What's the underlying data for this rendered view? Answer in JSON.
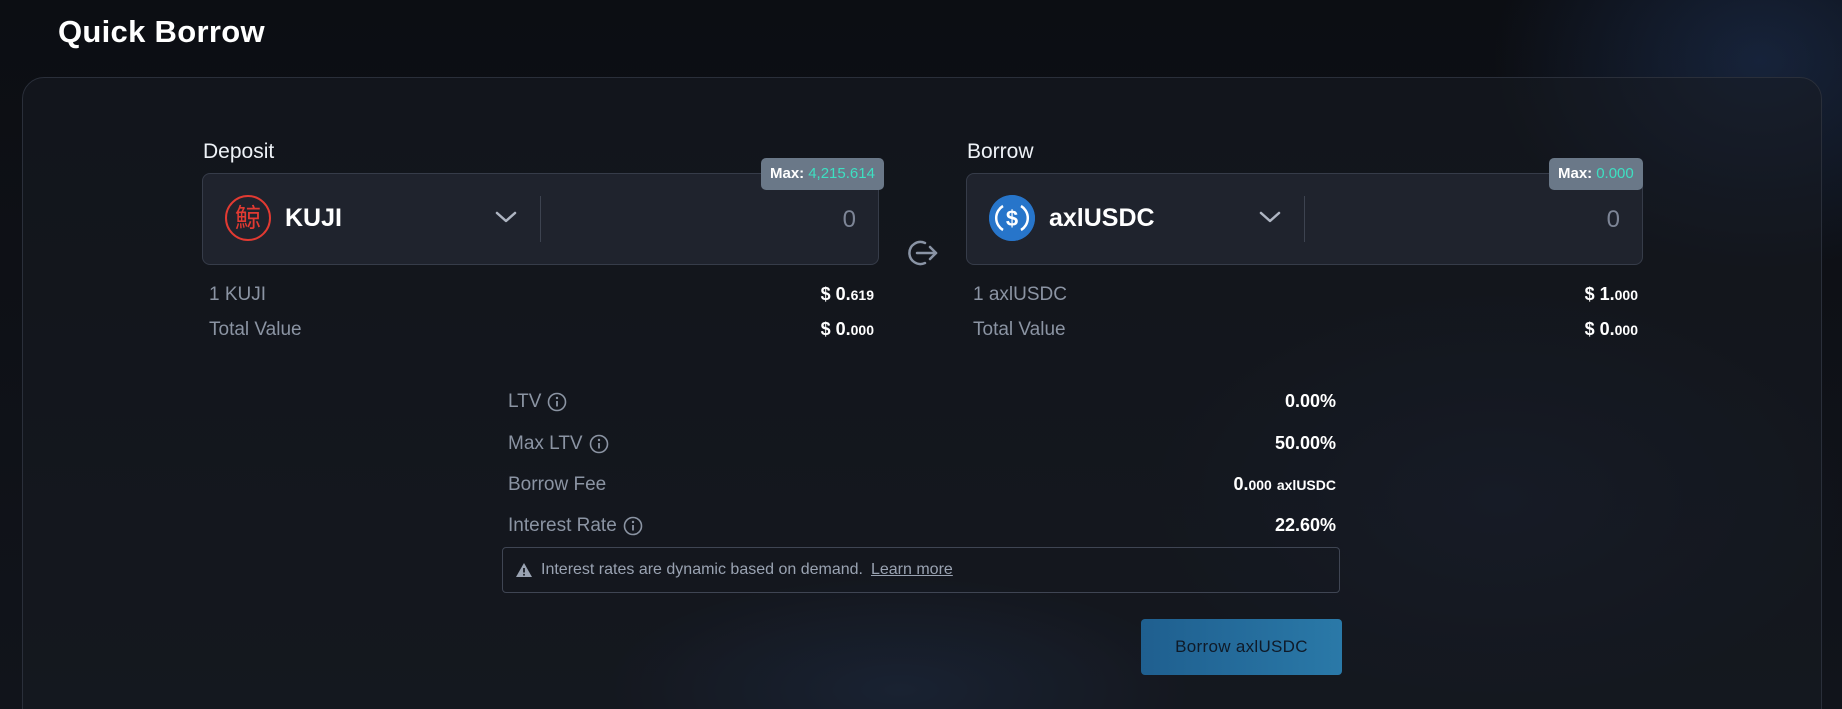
{
  "page": {
    "title": "Quick Borrow"
  },
  "deposit": {
    "label": "Deposit",
    "token": "KUJI",
    "logo_glyph": "鯨",
    "amount_placeholder": "0",
    "max_label": "Max:",
    "max_value": "4,215.614",
    "price_label": "1 KUJI",
    "price_currency": "$",
    "price_main": "0.",
    "price_dec": "619",
    "total_label": "Total Value",
    "total_currency": "$",
    "total_main": "0.",
    "total_dec": "000"
  },
  "borrow": {
    "label": "Borrow",
    "token": "axlUSDC",
    "amount_placeholder": "0",
    "max_label": "Max:",
    "max_value": "0.000",
    "price_label": "1 axlUSDC",
    "price_currency": "$",
    "price_main": "1.",
    "price_dec": "000",
    "total_label": "Total Value",
    "total_currency": "$",
    "total_main": "0.",
    "total_dec": "000"
  },
  "stats": {
    "ltv_label": "LTV",
    "ltv_value": "0.00%",
    "max_ltv_label": "Max LTV",
    "max_ltv_value": "50.00%",
    "fee_label": "Borrow Fee",
    "fee_main": "0.",
    "fee_dec": "000",
    "fee_unit": "axlUSDC",
    "interest_label": "Interest Rate",
    "interest_value": "22.60%"
  },
  "notice": {
    "text": "Interest rates are dynamic based on demand.",
    "link": "Learn more"
  },
  "action": {
    "borrow_button": "Borrow axlUSDC"
  },
  "colors": {
    "accent_teal": "#3de0c2",
    "button_blue": "#2a79a8",
    "kuji_red": "#e23a32",
    "usdc_blue": "#2775ca"
  },
  "icons": {
    "swap": "arrow-right-from-circle-icon",
    "info": "info-icon",
    "warning": "warning-triangle-icon",
    "chevron": "chevron-down-icon"
  }
}
